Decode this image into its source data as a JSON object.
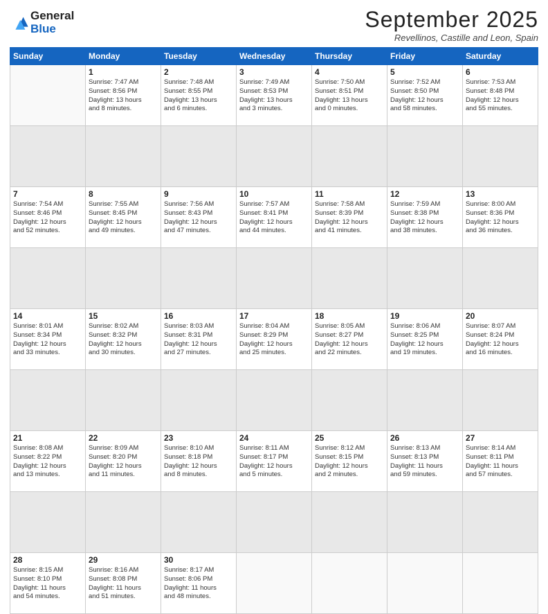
{
  "header": {
    "logo_line1": "General",
    "logo_line2": "Blue",
    "month_title": "September 2025",
    "location": "Revellinos, Castille and Leon, Spain"
  },
  "weekdays": [
    "Sunday",
    "Monday",
    "Tuesday",
    "Wednesday",
    "Thursday",
    "Friday",
    "Saturday"
  ],
  "weeks": [
    [
      {
        "day": "",
        "info": ""
      },
      {
        "day": "1",
        "info": "Sunrise: 7:47 AM\nSunset: 8:56 PM\nDaylight: 13 hours\nand 8 minutes."
      },
      {
        "day": "2",
        "info": "Sunrise: 7:48 AM\nSunset: 8:55 PM\nDaylight: 13 hours\nand 6 minutes."
      },
      {
        "day": "3",
        "info": "Sunrise: 7:49 AM\nSunset: 8:53 PM\nDaylight: 13 hours\nand 3 minutes."
      },
      {
        "day": "4",
        "info": "Sunrise: 7:50 AM\nSunset: 8:51 PM\nDaylight: 13 hours\nand 0 minutes."
      },
      {
        "day": "5",
        "info": "Sunrise: 7:52 AM\nSunset: 8:50 PM\nDaylight: 12 hours\nand 58 minutes."
      },
      {
        "day": "6",
        "info": "Sunrise: 7:53 AM\nSunset: 8:48 PM\nDaylight: 12 hours\nand 55 minutes."
      }
    ],
    [
      {
        "day": "7",
        "info": "Sunrise: 7:54 AM\nSunset: 8:46 PM\nDaylight: 12 hours\nand 52 minutes."
      },
      {
        "day": "8",
        "info": "Sunrise: 7:55 AM\nSunset: 8:45 PM\nDaylight: 12 hours\nand 49 minutes."
      },
      {
        "day": "9",
        "info": "Sunrise: 7:56 AM\nSunset: 8:43 PM\nDaylight: 12 hours\nand 47 minutes."
      },
      {
        "day": "10",
        "info": "Sunrise: 7:57 AM\nSunset: 8:41 PM\nDaylight: 12 hours\nand 44 minutes."
      },
      {
        "day": "11",
        "info": "Sunrise: 7:58 AM\nSunset: 8:39 PM\nDaylight: 12 hours\nand 41 minutes."
      },
      {
        "day": "12",
        "info": "Sunrise: 7:59 AM\nSunset: 8:38 PM\nDaylight: 12 hours\nand 38 minutes."
      },
      {
        "day": "13",
        "info": "Sunrise: 8:00 AM\nSunset: 8:36 PM\nDaylight: 12 hours\nand 36 minutes."
      }
    ],
    [
      {
        "day": "14",
        "info": "Sunrise: 8:01 AM\nSunset: 8:34 PM\nDaylight: 12 hours\nand 33 minutes."
      },
      {
        "day": "15",
        "info": "Sunrise: 8:02 AM\nSunset: 8:32 PM\nDaylight: 12 hours\nand 30 minutes."
      },
      {
        "day": "16",
        "info": "Sunrise: 8:03 AM\nSunset: 8:31 PM\nDaylight: 12 hours\nand 27 minutes."
      },
      {
        "day": "17",
        "info": "Sunrise: 8:04 AM\nSunset: 8:29 PM\nDaylight: 12 hours\nand 25 minutes."
      },
      {
        "day": "18",
        "info": "Sunrise: 8:05 AM\nSunset: 8:27 PM\nDaylight: 12 hours\nand 22 minutes."
      },
      {
        "day": "19",
        "info": "Sunrise: 8:06 AM\nSunset: 8:25 PM\nDaylight: 12 hours\nand 19 minutes."
      },
      {
        "day": "20",
        "info": "Sunrise: 8:07 AM\nSunset: 8:24 PM\nDaylight: 12 hours\nand 16 minutes."
      }
    ],
    [
      {
        "day": "21",
        "info": "Sunrise: 8:08 AM\nSunset: 8:22 PM\nDaylight: 12 hours\nand 13 minutes."
      },
      {
        "day": "22",
        "info": "Sunrise: 8:09 AM\nSunset: 8:20 PM\nDaylight: 12 hours\nand 11 minutes."
      },
      {
        "day": "23",
        "info": "Sunrise: 8:10 AM\nSunset: 8:18 PM\nDaylight: 12 hours\nand 8 minutes."
      },
      {
        "day": "24",
        "info": "Sunrise: 8:11 AM\nSunset: 8:17 PM\nDaylight: 12 hours\nand 5 minutes."
      },
      {
        "day": "25",
        "info": "Sunrise: 8:12 AM\nSunset: 8:15 PM\nDaylight: 12 hours\nand 2 minutes."
      },
      {
        "day": "26",
        "info": "Sunrise: 8:13 AM\nSunset: 8:13 PM\nDaylight: 11 hours\nand 59 minutes."
      },
      {
        "day": "27",
        "info": "Sunrise: 8:14 AM\nSunset: 8:11 PM\nDaylight: 11 hours\nand 57 minutes."
      }
    ],
    [
      {
        "day": "28",
        "info": "Sunrise: 8:15 AM\nSunset: 8:10 PM\nDaylight: 11 hours\nand 54 minutes."
      },
      {
        "day": "29",
        "info": "Sunrise: 8:16 AM\nSunset: 8:08 PM\nDaylight: 11 hours\nand 51 minutes."
      },
      {
        "day": "30",
        "info": "Sunrise: 8:17 AM\nSunset: 8:06 PM\nDaylight: 11 hours\nand 48 minutes."
      },
      {
        "day": "",
        "info": ""
      },
      {
        "day": "",
        "info": ""
      },
      {
        "day": "",
        "info": ""
      },
      {
        "day": "",
        "info": ""
      }
    ]
  ]
}
